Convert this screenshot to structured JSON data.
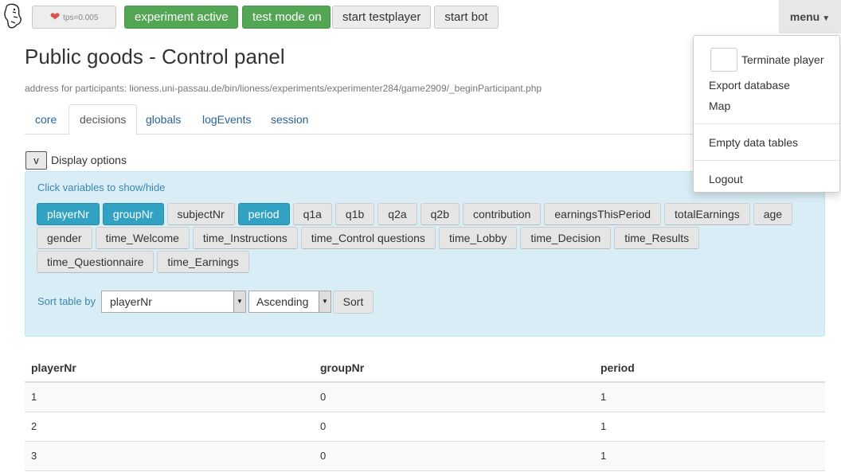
{
  "topbar": {
    "tps_label": "tps=0.005",
    "experiment_active": "experiment active",
    "test_mode": "test mode on",
    "start_testplayer": "start testplayer",
    "start_bot": "start bot",
    "menu": "menu"
  },
  "page": {
    "title": "Public goods - Control panel",
    "address": "address for participants: lioness.uni-passau.de/bin/lioness/experiments/experimenter284/game2909/_beginParticipant.php"
  },
  "tabs": [
    "core",
    "decisions",
    "globals",
    "logEvents",
    "session"
  ],
  "active_tab": "decisions",
  "display_options": {
    "toggle": "v",
    "label": "Display options",
    "hint": "Click variables to show/hide",
    "variables": [
      {
        "name": "playerNr",
        "on": true
      },
      {
        "name": "groupNr",
        "on": true
      },
      {
        "name": "subjectNr",
        "on": false
      },
      {
        "name": "period",
        "on": true
      },
      {
        "name": "q1a",
        "on": false
      },
      {
        "name": "q1b",
        "on": false
      },
      {
        "name": "q2a",
        "on": false
      },
      {
        "name": "q2b",
        "on": false
      },
      {
        "name": "contribution",
        "on": false
      },
      {
        "name": "earningsThisPeriod",
        "on": false
      },
      {
        "name": "totalEarnings",
        "on": false
      },
      {
        "name": "age",
        "on": false
      },
      {
        "name": "gender",
        "on": false
      },
      {
        "name": "time_Welcome",
        "on": false
      },
      {
        "name": "time_Instructions",
        "on": false
      },
      {
        "name": "time_Control questions",
        "on": false
      },
      {
        "name": "time_Lobby",
        "on": false
      },
      {
        "name": "time_Decision",
        "on": false
      },
      {
        "name": "time_Results",
        "on": false
      },
      {
        "name": "time_Questionnaire",
        "on": false
      },
      {
        "name": "time_Earnings",
        "on": false
      }
    ],
    "sort_label": "Sort table by",
    "sort_value": "playerNr",
    "order_value": "Ascending",
    "sort_button": "Sort"
  },
  "table": {
    "columns": [
      "playerNr",
      "groupNr",
      "period"
    ],
    "rows": [
      [
        "1",
        "0",
        "1"
      ],
      [
        "2",
        "0",
        "1"
      ],
      [
        "3",
        "0",
        "1"
      ]
    ]
  },
  "menu_items": {
    "terminate": "Terminate player",
    "export": "Export database",
    "map": "Map",
    "empty": "Empty data tables",
    "logout": "Logout"
  },
  "colors": {
    "green": "#53a653",
    "var_on": "#32a2c2",
    "panel": "#d9edf7"
  }
}
